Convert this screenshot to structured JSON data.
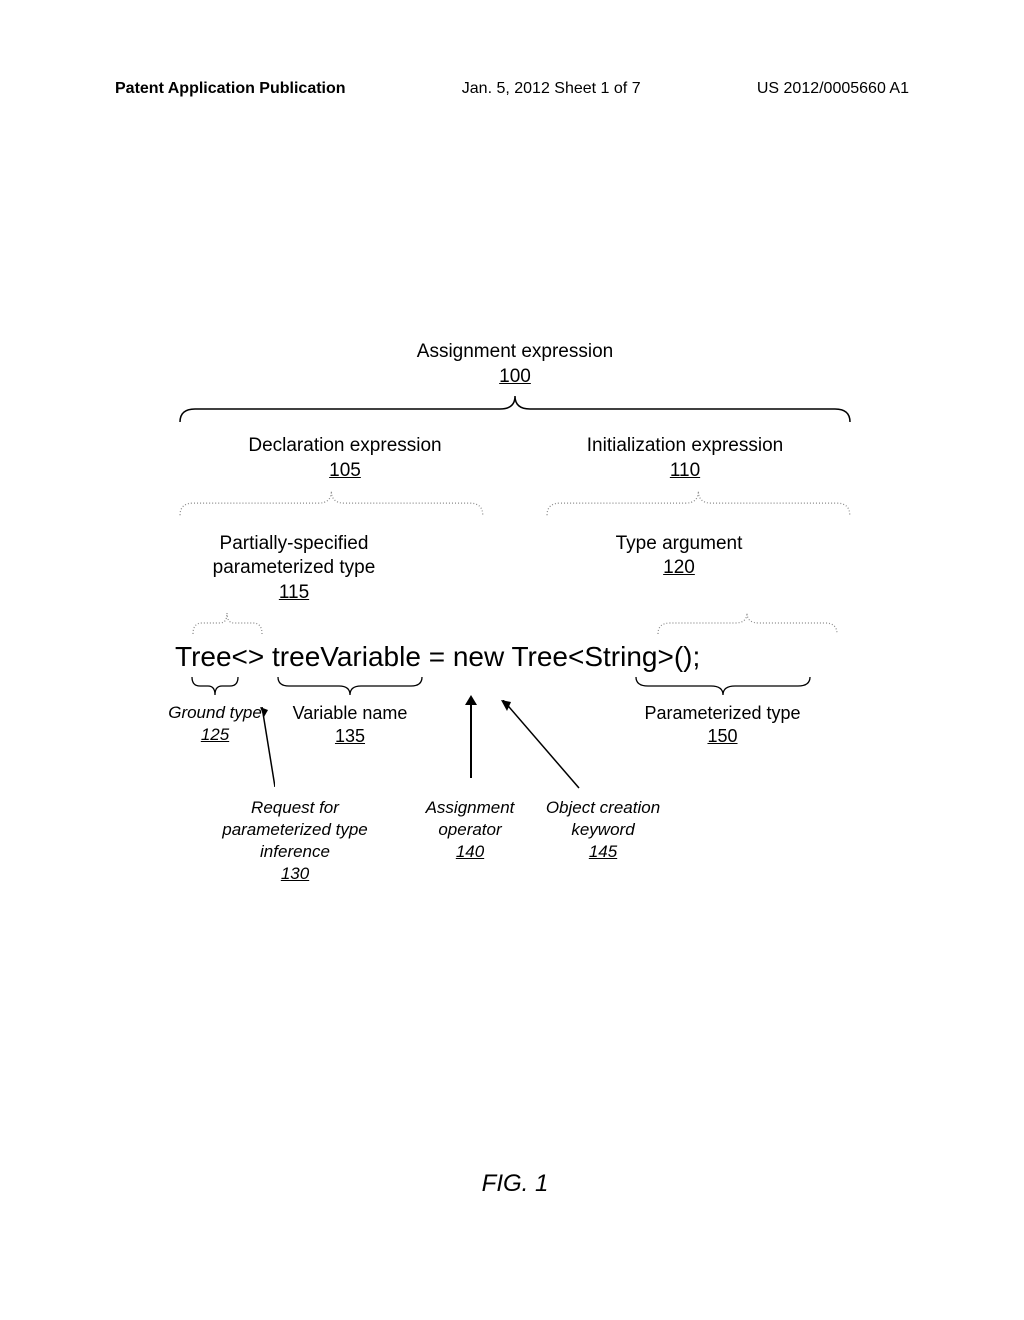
{
  "header": {
    "left": "Patent Application Publication",
    "center": "Jan. 5, 2012  Sheet 1 of 7",
    "right": "US 2012/0005660 A1"
  },
  "diagram": {
    "top_label": "Assignment expression",
    "top_ref": "100",
    "decl_label": "Declaration expression",
    "decl_ref": "105",
    "init_label": "Initialization expression",
    "init_ref": "110",
    "partial_label": "Partially-specified parameterized type",
    "partial_ref": "115",
    "typearg_label": "Type argument",
    "typearg_ref": "120",
    "code": "Tree<> treeVariable = new Tree<String>();",
    "ground_label": "Ground type",
    "ground_ref": "125",
    "varname_label": "Variable name",
    "varname_ref": "135",
    "paramtype_label": "Parameterized type",
    "paramtype_ref": "150",
    "request_label": "Request for parameterized type inference",
    "request_ref": "130",
    "assign_label": "Assignment operator",
    "assign_ref": "140",
    "objcreate_label": "Object creation keyword",
    "objcreate_ref": "145",
    "figure": "FIG. 1"
  }
}
